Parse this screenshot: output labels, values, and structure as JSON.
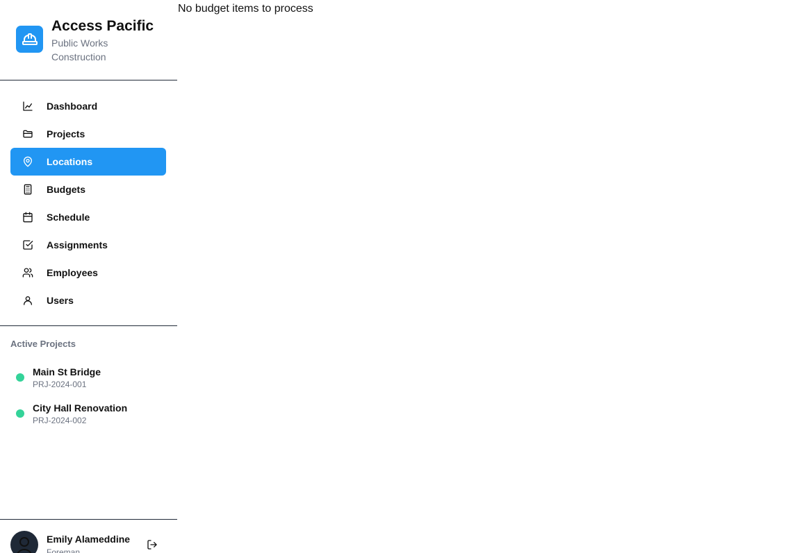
{
  "brand": {
    "title": "Access Pacific",
    "subtitle": "Public Works Construction",
    "logo_icon": "hard-hat-icon",
    "accent_color": "#2196f3"
  },
  "nav": {
    "items": [
      {
        "label": "Dashboard",
        "icon": "chart-line-icon",
        "active": false
      },
      {
        "label": "Projects",
        "icon": "folder-icon",
        "active": false
      },
      {
        "label": "Locations",
        "icon": "map-pin-icon",
        "active": true
      },
      {
        "label": "Budgets",
        "icon": "calculator-icon",
        "active": false
      },
      {
        "label": "Schedule",
        "icon": "calendar-icon",
        "active": false
      },
      {
        "label": "Assignments",
        "icon": "checkbox-icon",
        "active": false
      },
      {
        "label": "Employees",
        "icon": "users-icon",
        "active": false
      },
      {
        "label": "Users",
        "icon": "user-icon",
        "active": false
      }
    ]
  },
  "active_projects": {
    "heading": "Active Projects",
    "status_color": "#34d399",
    "items": [
      {
        "name": "Main St Bridge",
        "code": "PRJ-2024-001"
      },
      {
        "name": "City Hall Renovation",
        "code": "PRJ-2024-002"
      }
    ]
  },
  "user": {
    "name": "Emily Alameddine",
    "role": "Foreman",
    "logout_icon": "logout-icon"
  },
  "main": {
    "message": "No budget items to process"
  }
}
